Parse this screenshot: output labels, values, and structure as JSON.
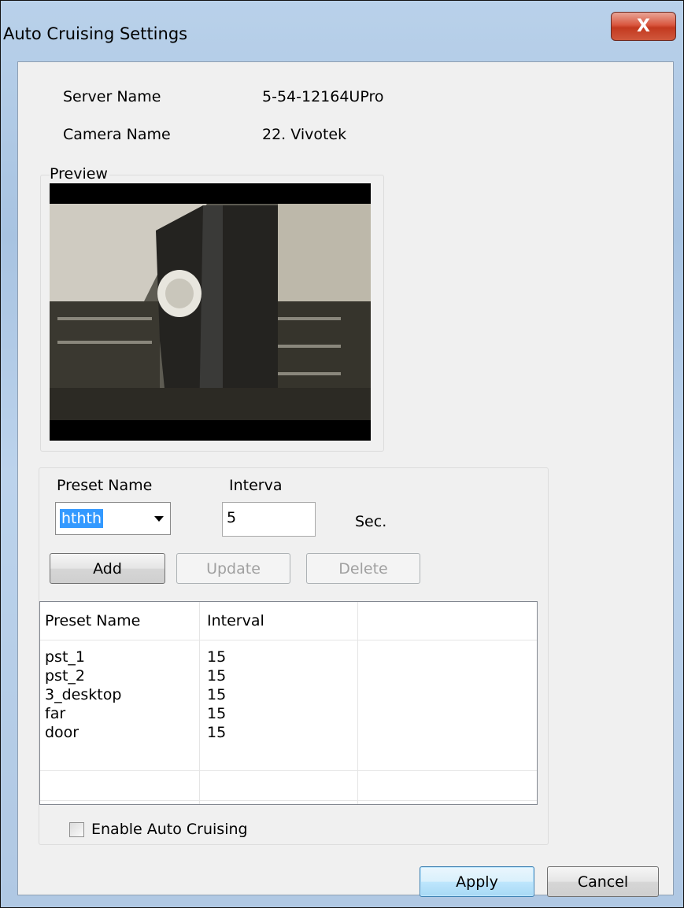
{
  "window": {
    "title": "Auto Cruising Settings",
    "close_glyph": "X"
  },
  "info": {
    "server_label": "Server Name",
    "server_value": "5-54-12164UPro",
    "camera_label": "Camera Name",
    "camera_value": "22. Vivotek"
  },
  "preview": {
    "label": "Preview"
  },
  "preset_form": {
    "preset_label": "Preset Name",
    "interval_label": "Interva",
    "preset_selected": "hthth",
    "interval_value": "5",
    "unit": "Sec.",
    "add_label": "Add",
    "update_label": "Update",
    "delete_label": "Delete"
  },
  "table": {
    "columns": [
      "Preset Name",
      "Interval",
      ""
    ],
    "rows": [
      {
        "name": "pst_1",
        "interval": "15"
      },
      {
        "name": "pst_2",
        "interval": "15"
      },
      {
        "name": "3_desktop",
        "interval": "15"
      },
      {
        "name": "far",
        "interval": "15"
      },
      {
        "name": "door",
        "interval": "15"
      }
    ]
  },
  "enable_label": "Enable Auto Cruising",
  "enable_checked": false,
  "footer": {
    "apply_label": "Apply",
    "cancel_label": "Cancel"
  }
}
